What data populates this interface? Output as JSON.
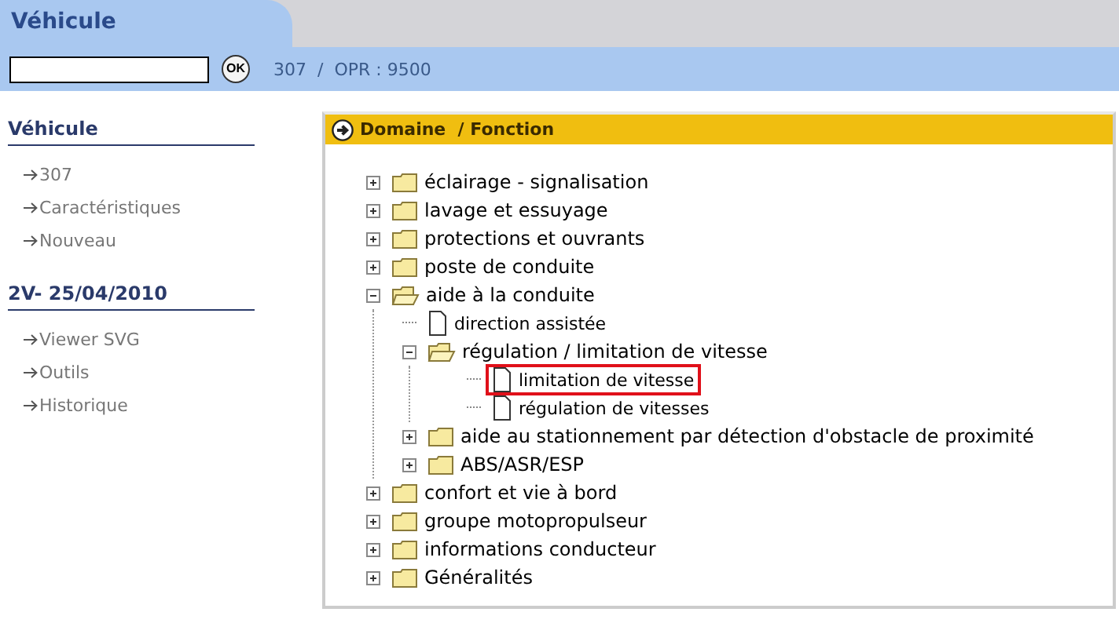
{
  "header": {
    "tab": "Véhicule",
    "ok_button": "OK",
    "breadcrumb": "307  /  OPR : 9500"
  },
  "sidebar": {
    "sections": [
      {
        "title": "Véhicule",
        "items": [
          "307",
          "Caractéristiques",
          "Nouveau"
        ]
      },
      {
        "title": "2V- 25/04/2010",
        "items": [
          "Viewer SVG",
          "Outils",
          "Historique"
        ]
      }
    ]
  },
  "panel": {
    "title": "Domaine  / Fonction",
    "tree": [
      {
        "kind": "folder",
        "label": "éclairage - signalisation",
        "expanded": false,
        "selected": false
      },
      {
        "kind": "folder",
        "label": "lavage et essuyage",
        "expanded": false,
        "selected": false
      },
      {
        "kind": "folder",
        "label": "protections et ouvrants",
        "expanded": false,
        "selected": false
      },
      {
        "kind": "folder",
        "label": "poste de conduite",
        "expanded": false,
        "selected": false
      },
      {
        "kind": "folder",
        "label": "aide à la conduite",
        "expanded": true,
        "selected": false,
        "children": [
          {
            "kind": "document",
            "label": "direction assistée",
            "selected": false
          },
          {
            "kind": "folder",
            "label": "régulation / limitation de vitesse",
            "expanded": true,
            "selected": false,
            "children": [
              {
                "kind": "document",
                "label": "limitation de vitesse",
                "selected": true
              },
              {
                "kind": "document",
                "label": "régulation de vitesses",
                "selected": false
              }
            ]
          },
          {
            "kind": "folder",
            "label": "aide au stationnement par détection d'obstacle de proximité",
            "expanded": false,
            "selected": false
          },
          {
            "kind": "folder",
            "label": "ABS/ASR/ESP",
            "expanded": false,
            "selected": false
          }
        ]
      },
      {
        "kind": "folder",
        "label": "confort et vie à bord",
        "expanded": false,
        "selected": false
      },
      {
        "kind": "folder",
        "label": "groupe motopropulseur",
        "expanded": false,
        "selected": false
      },
      {
        "kind": "folder",
        "label": "informations conducteur",
        "expanded": false,
        "selected": false
      },
      {
        "kind": "folder",
        "label": "Généralités",
        "expanded": false,
        "selected": false
      }
    ]
  }
}
